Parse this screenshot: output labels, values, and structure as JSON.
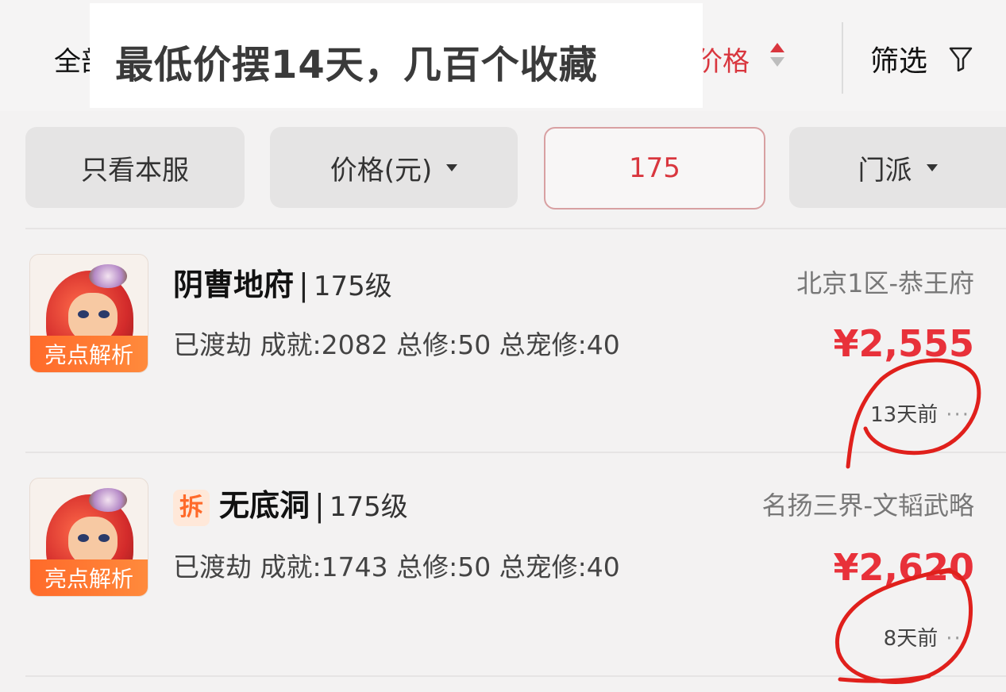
{
  "topbar": {
    "all_label": "全部",
    "price_sort_label": "价格",
    "filter_label": "筛选"
  },
  "overlay": {
    "caption": "最低价摆14天，几百个收藏"
  },
  "chips": [
    {
      "label": "只看本服",
      "has_caret": false,
      "active": false
    },
    {
      "label": "价格(元)",
      "has_caret": true,
      "active": false
    },
    {
      "label": "175",
      "has_caret": false,
      "active": true
    },
    {
      "label": "门派",
      "has_caret": true,
      "active": false
    }
  ],
  "items": [
    {
      "has_chai_tag": false,
      "chai_tag": "",
      "name": "阴曹地府",
      "level": "175级",
      "server": "北京1区-恭王府",
      "stats": "已渡劫 成就:2082 总修:50 总宠修:40",
      "price": "¥2,555",
      "time": "13天前",
      "badge": "亮点解析"
    },
    {
      "has_chai_tag": true,
      "chai_tag": "拆",
      "name": "无底洞",
      "level": "175级",
      "server": "名扬三界-文韬武略",
      "stats": "已渡劫 成就:1743 总修:50 总宠修:40",
      "price": "¥2,620",
      "time": "8天前",
      "badge": "亮点解析"
    }
  ],
  "colors": {
    "accent_red": "#d9363e",
    "price_red": "#e8313a",
    "badge_orange": "#ff6a2a",
    "annotation_red": "#e0201c"
  }
}
